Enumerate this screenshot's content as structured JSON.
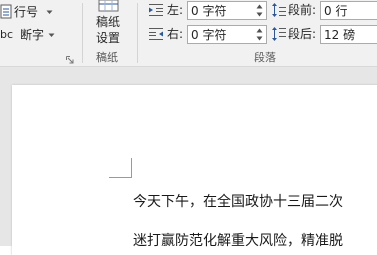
{
  "ribbon": {
    "line_number_label": "行号",
    "hyphenation_label": "断字",
    "hyphenation_prefix": "bc",
    "manuscript_line1": "稿纸",
    "manuscript_line2": "设置",
    "manuscript_group_label": "稿纸",
    "indent": {
      "left_label": "左:",
      "left_value": "0 字符",
      "right_label": "右:",
      "right_value": "0 字符"
    },
    "spacing": {
      "before_label": "段前:",
      "before_value": "0 行",
      "after_label": "段后:",
      "after_value": "12 磅"
    },
    "paragraph_group_label": "段落"
  },
  "document": {
    "line1": "今天下午，在全国政协十三届二次",
    "line2": "迷打赢防范化解重大风险，精准脱"
  },
  "colors": {
    "ribbon_bg": "#f1f1f1",
    "workspace_bg": "#e6e6e6",
    "accent_blue": "#2b579a"
  }
}
